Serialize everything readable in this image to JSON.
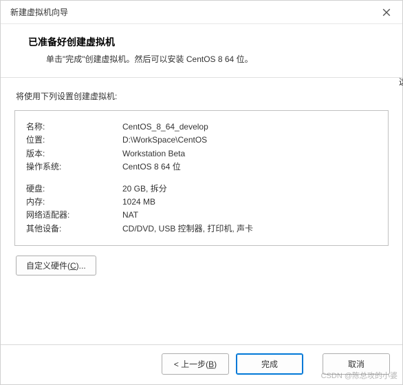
{
  "titlebar": {
    "title": "新建虚拟机向导"
  },
  "header": {
    "title": "已准备好创建虚拟机",
    "subtitle": "单击\"完成\"创建虚拟机。然后可以安装 CentOS 8 64 位。"
  },
  "content": {
    "intro": "将使用下列设置创建虚拟机:",
    "settings": {
      "name_label": "名称:",
      "name_value": "CentOS_8_64_develop",
      "location_label": "位置:",
      "location_value": "D:\\WorkSpace\\CentOS",
      "version_label": "版本:",
      "version_value": "Workstation Beta",
      "os_label": "操作系统:",
      "os_value": "CentOS 8 64 位",
      "disk_label": "硬盘:",
      "disk_value": "20 GB, 拆分",
      "memory_label": "内存:",
      "memory_value": "1024 MB",
      "network_label": "网络适配器:",
      "network_value": "NAT",
      "other_label": "其他设备:",
      "other_value": "CD/DVD, USB 控制器, 打印机, 声卡"
    },
    "customize_label_pre": "自定义硬件(",
    "customize_key": "C",
    "customize_label_post": ")..."
  },
  "footer": {
    "back_pre": "< 上一步(",
    "back_key": "B",
    "back_post": ")",
    "finish": "完成",
    "cancel": "取消"
  },
  "watermark": "CSDN @陈总攻的小婆",
  "edge_hint": "这"
}
